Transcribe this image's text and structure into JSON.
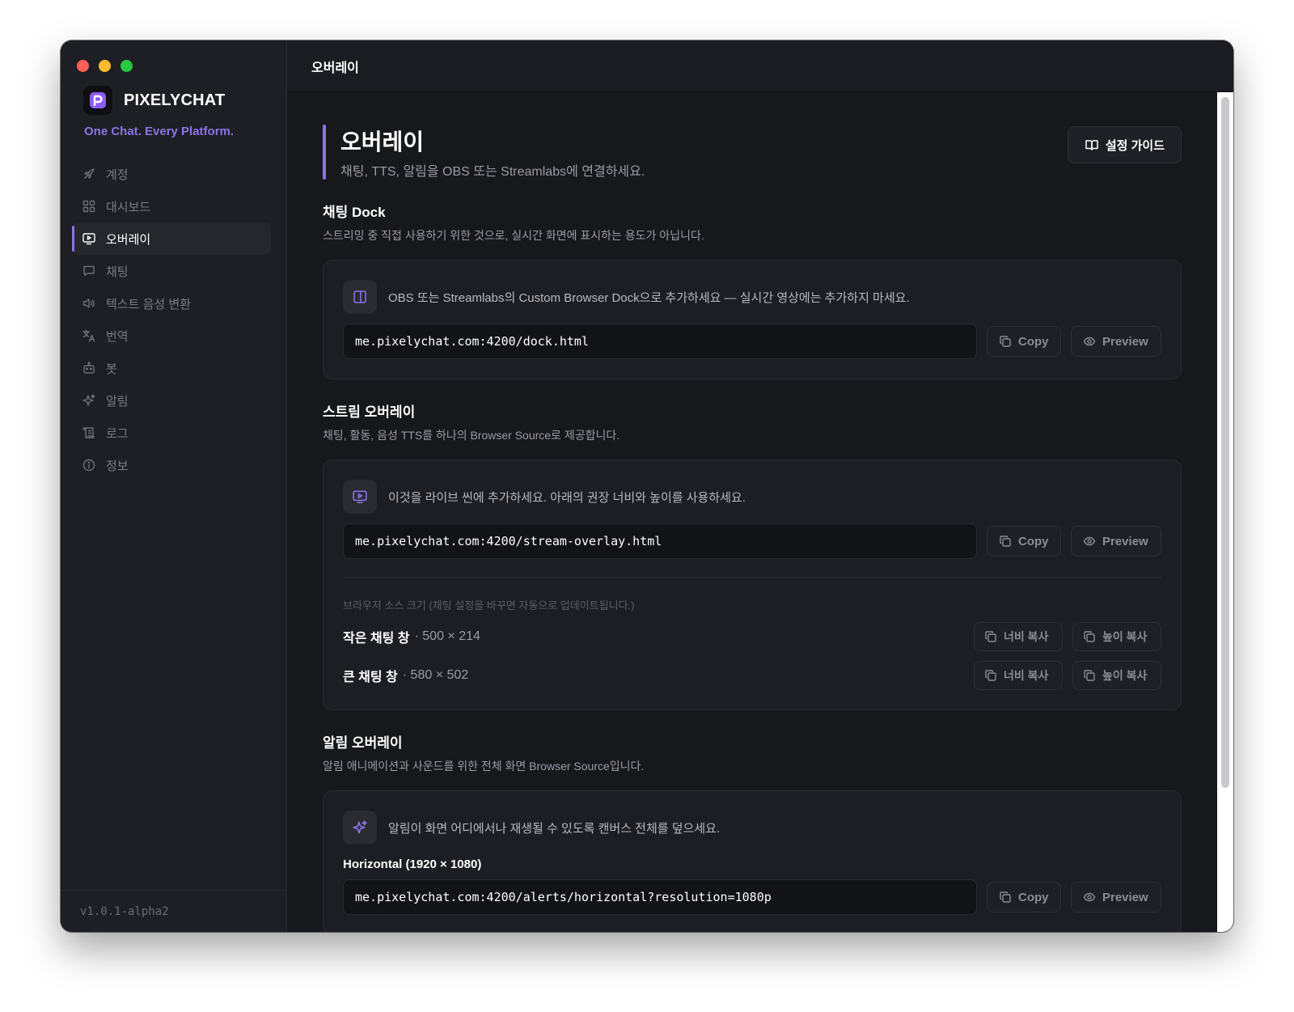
{
  "window": {
    "header_title": "오버레이"
  },
  "sidebar": {
    "brand": "PIXELYCHAT",
    "tagline": "One Chat. Every Platform.",
    "items": [
      {
        "label": "계정",
        "icon": "rocket-icon"
      },
      {
        "label": "대시보드",
        "icon": "grid-icon"
      },
      {
        "label": "오버레이",
        "icon": "monitor-play-icon",
        "active": true
      },
      {
        "label": "채팅",
        "icon": "chat-bubble-icon"
      },
      {
        "label": "텍스트 음성 변환",
        "icon": "speaker-icon"
      },
      {
        "label": "번역",
        "icon": "translate-icon"
      },
      {
        "label": "봇",
        "icon": "bot-icon"
      },
      {
        "label": "알림",
        "icon": "sparkle-icon"
      },
      {
        "label": "로그",
        "icon": "scroll-icon"
      },
      {
        "label": "정보",
        "icon": "info-icon"
      }
    ],
    "version": "v1.0.1-alpha2"
  },
  "page": {
    "title": "오버레이",
    "subtitle": "채팅, TTS, 알림을 OBS 또는 Streamlabs에 연결하세요.",
    "guide_button": "설정 가이드"
  },
  "sections": {
    "dock": {
      "title": "채팅 Dock",
      "subtitle": "스트리밍 중 직접 사용하기 위한 것으로, 실시간 화면에 표시하는 용도가 아닙니다.",
      "info": "OBS 또는 Streamlabs의 Custom Browser Dock으로 추가하세요 — 실시간 영상에는 추가하지 마세요.",
      "url": "me.pixelychat.com:4200/dock.html"
    },
    "stream": {
      "title": "스트림 오버레이",
      "subtitle": "채팅, 활동, 음성 TTS를 하나의 Browser Source로 제공합니다.",
      "info": "이것을 라이브 씬에 추가하세요. 아래의 권장 너비와 높이를 사용하세요.",
      "url": "me.pixelychat.com:4200/stream-overlay.html",
      "size_caption": "브라우저 소스 크기 (채팅 설정을 바꾸면 자동으로 업데이트됩니다.)",
      "sizes": [
        {
          "label": "작은 채팅 창",
          "dims": "· 500 × 214"
        },
        {
          "label": "큰 채팅 창",
          "dims": "· 580 × 502"
        }
      ]
    },
    "alerts": {
      "title": "알림 오버레이",
      "subtitle": "알림 애니메이션과 사운드를 위한 전체 화면 Browser Source입니다.",
      "info": "알림이 화면 어디에서나 재생될 수 있도록 캔버스 전체를 덮으세요.",
      "resolution_label": "Horizontal (1920 × 1080)",
      "url": "me.pixelychat.com:4200/alerts/horizontal?resolution=1080p"
    }
  },
  "buttons": {
    "copy": "Copy",
    "preview": "Preview",
    "copy_width": "너비 복사",
    "copy_height": "높이 복사"
  },
  "colors": {
    "accent": "#8b73e6",
    "window_bg": "#17181c",
    "sidebar_bg": "#1e1f24"
  }
}
